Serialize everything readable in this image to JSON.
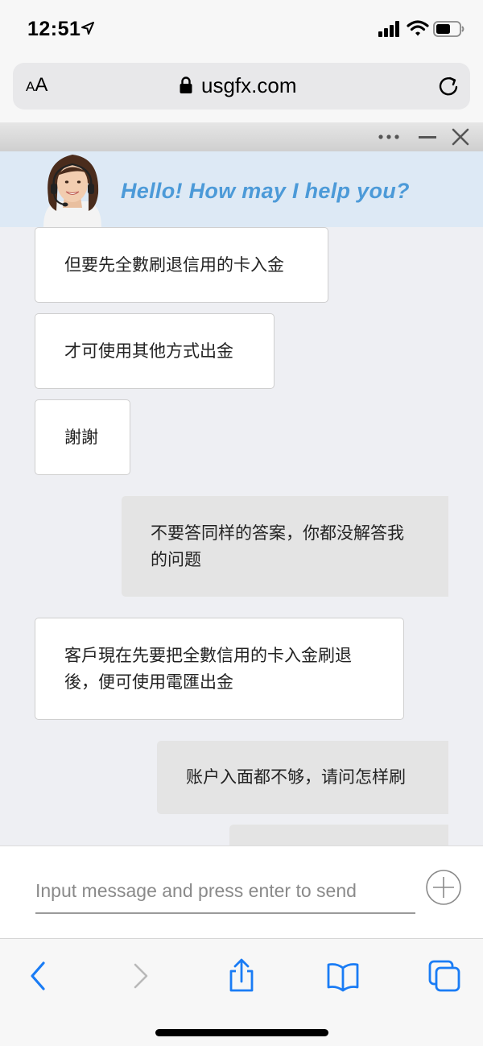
{
  "status_bar": {
    "time": "12:51",
    "icons": [
      "location-arrow-icon",
      "signal-bars-icon",
      "wifi-icon",
      "battery-icon"
    ]
  },
  "browser": {
    "text_size_button": {
      "small": "A",
      "large": "A"
    },
    "url": "usgfx.com",
    "icons": [
      "lock-icon",
      "reload-icon"
    ]
  },
  "chat": {
    "window_controls": [
      "more-icon",
      "minimize-icon",
      "close-icon"
    ],
    "greeting": "Hello! How may I help you?",
    "messages": [
      {
        "sender": "agent",
        "text": "但要先全數刷退信用的卡入金"
      },
      {
        "sender": "agent",
        "text": "才可使用其他方式出金"
      },
      {
        "sender": "agent",
        "text": "謝謝"
      },
      {
        "sender": "user",
        "text": "不要答同样的答案，你都没解答我的问题"
      },
      {
        "sender": "agent",
        "text": "客戶現在先要把全數信用的卡入金刷退後，便可使用電匯出金"
      },
      {
        "sender": "user",
        "text": "账户入面都不够，请问怎样刷"
      },
      {
        "sender": "user",
        "text": ""
      }
    ],
    "input": {
      "placeholder": "Input message and press enter to send",
      "value": ""
    }
  },
  "toolbar": {
    "buttons": [
      "back-icon",
      "forward-icon",
      "share-icon",
      "bookmarks-icon",
      "tabs-icon"
    ]
  },
  "colors": {
    "greeting": "#4c9ad8",
    "banner_bg": "#dde9f5",
    "messages_bg": "#eeeff3",
    "agent_bubble": "#ffffff",
    "user_bubble": "#e4e4e4",
    "ios_blue": "#1a7cf5"
  }
}
